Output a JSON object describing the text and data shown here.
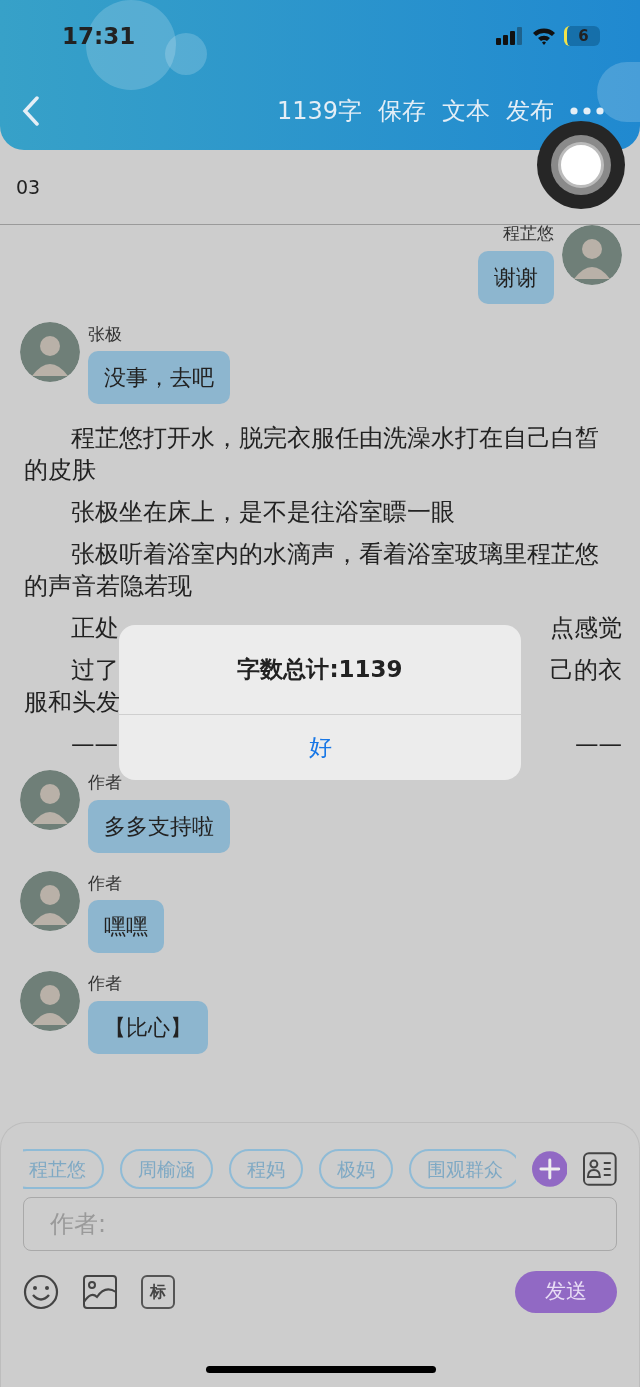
{
  "status_bar": {
    "time": "17:31",
    "battery": "6"
  },
  "nav": {
    "actions": [
      "1139字",
      "保存",
      "文本",
      "发布"
    ]
  },
  "chapter": {
    "title": "03"
  },
  "messages": [
    {
      "kind": "outgoing",
      "name": "程芷悠",
      "text": "谢谢"
    },
    {
      "kind": "incoming",
      "name": "张极",
      "text": "没事，去吧"
    },
    {
      "kind": "paragraph",
      "text": "程芷悠打开水，脱完衣服任由洗澡水打在自己白皙的皮肤"
    },
    {
      "kind": "paragraph",
      "text": "张极坐在床上，是不是往浴室瞟一眼"
    },
    {
      "kind": "paragraph",
      "text": "张极听着浴室内的水滴声，看着浴室玻璃里程芷悠的声音若隐若现"
    },
    {
      "kind": "covered",
      "lines": [
        {
          "left": "正处",
          "right": "点感觉",
          "indent": true
        }
      ]
    },
    {
      "kind": "covered",
      "lines": [
        {
          "left": "过了",
          "right": "己的衣",
          "indent": true
        },
        {
          "left": "服和头发",
          "indent": false
        }
      ]
    },
    {
      "kind": "covered",
      "lines": [
        {
          "left": "——",
          "right": "——"
        }
      ]
    },
    {
      "kind": "incoming",
      "name": "作者",
      "text": "多多支持啦"
    },
    {
      "kind": "incoming",
      "name": "作者",
      "text": "嘿嘿"
    },
    {
      "kind": "incoming",
      "name": "作者",
      "text": "【比心】"
    }
  ],
  "dialog": {
    "title": "字数总计:1139",
    "button": "好"
  },
  "composer": {
    "roles": [
      "程芷悠",
      "周榆涵",
      "程妈",
      "极妈",
      "围观群众"
    ],
    "placeholder": "作者:",
    "tag_button": "标",
    "send": "发送"
  }
}
